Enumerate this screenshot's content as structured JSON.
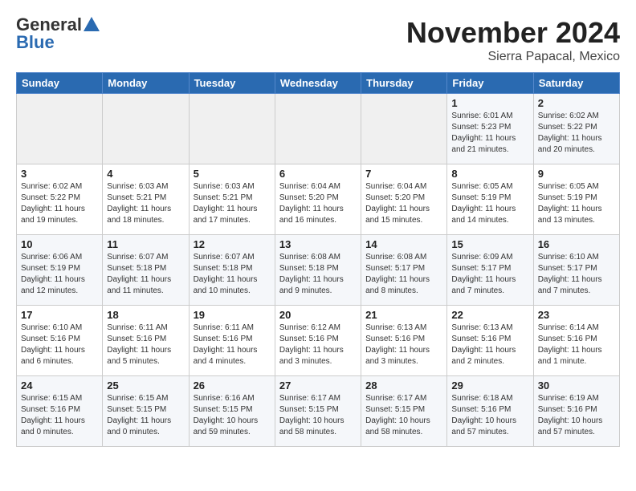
{
  "header": {
    "logo_general": "General",
    "logo_blue": "Blue",
    "month": "November 2024",
    "location": "Sierra Papacal, Mexico"
  },
  "weekdays": [
    "Sunday",
    "Monday",
    "Tuesday",
    "Wednesday",
    "Thursday",
    "Friday",
    "Saturday"
  ],
  "weeks": [
    [
      {
        "day": "",
        "content": ""
      },
      {
        "day": "",
        "content": ""
      },
      {
        "day": "",
        "content": ""
      },
      {
        "day": "",
        "content": ""
      },
      {
        "day": "",
        "content": ""
      },
      {
        "day": "1",
        "content": "Sunrise: 6:01 AM\nSunset: 5:23 PM\nDaylight: 11 hours and 21 minutes."
      },
      {
        "day": "2",
        "content": "Sunrise: 6:02 AM\nSunset: 5:22 PM\nDaylight: 11 hours and 20 minutes."
      }
    ],
    [
      {
        "day": "3",
        "content": "Sunrise: 6:02 AM\nSunset: 5:22 PM\nDaylight: 11 hours and 19 minutes."
      },
      {
        "day": "4",
        "content": "Sunrise: 6:03 AM\nSunset: 5:21 PM\nDaylight: 11 hours and 18 minutes."
      },
      {
        "day": "5",
        "content": "Sunrise: 6:03 AM\nSunset: 5:21 PM\nDaylight: 11 hours and 17 minutes."
      },
      {
        "day": "6",
        "content": "Sunrise: 6:04 AM\nSunset: 5:20 PM\nDaylight: 11 hours and 16 minutes."
      },
      {
        "day": "7",
        "content": "Sunrise: 6:04 AM\nSunset: 5:20 PM\nDaylight: 11 hours and 15 minutes."
      },
      {
        "day": "8",
        "content": "Sunrise: 6:05 AM\nSunset: 5:19 PM\nDaylight: 11 hours and 14 minutes."
      },
      {
        "day": "9",
        "content": "Sunrise: 6:05 AM\nSunset: 5:19 PM\nDaylight: 11 hours and 13 minutes."
      }
    ],
    [
      {
        "day": "10",
        "content": "Sunrise: 6:06 AM\nSunset: 5:19 PM\nDaylight: 11 hours and 12 minutes."
      },
      {
        "day": "11",
        "content": "Sunrise: 6:07 AM\nSunset: 5:18 PM\nDaylight: 11 hours and 11 minutes."
      },
      {
        "day": "12",
        "content": "Sunrise: 6:07 AM\nSunset: 5:18 PM\nDaylight: 11 hours and 10 minutes."
      },
      {
        "day": "13",
        "content": "Sunrise: 6:08 AM\nSunset: 5:18 PM\nDaylight: 11 hours and 9 minutes."
      },
      {
        "day": "14",
        "content": "Sunrise: 6:08 AM\nSunset: 5:17 PM\nDaylight: 11 hours and 8 minutes."
      },
      {
        "day": "15",
        "content": "Sunrise: 6:09 AM\nSunset: 5:17 PM\nDaylight: 11 hours and 7 minutes."
      },
      {
        "day": "16",
        "content": "Sunrise: 6:10 AM\nSunset: 5:17 PM\nDaylight: 11 hours and 7 minutes."
      }
    ],
    [
      {
        "day": "17",
        "content": "Sunrise: 6:10 AM\nSunset: 5:16 PM\nDaylight: 11 hours and 6 minutes."
      },
      {
        "day": "18",
        "content": "Sunrise: 6:11 AM\nSunset: 5:16 PM\nDaylight: 11 hours and 5 minutes."
      },
      {
        "day": "19",
        "content": "Sunrise: 6:11 AM\nSunset: 5:16 PM\nDaylight: 11 hours and 4 minutes."
      },
      {
        "day": "20",
        "content": "Sunrise: 6:12 AM\nSunset: 5:16 PM\nDaylight: 11 hours and 3 minutes."
      },
      {
        "day": "21",
        "content": "Sunrise: 6:13 AM\nSunset: 5:16 PM\nDaylight: 11 hours and 3 minutes."
      },
      {
        "day": "22",
        "content": "Sunrise: 6:13 AM\nSunset: 5:16 PM\nDaylight: 11 hours and 2 minutes."
      },
      {
        "day": "23",
        "content": "Sunrise: 6:14 AM\nSunset: 5:16 PM\nDaylight: 11 hours and 1 minute."
      }
    ],
    [
      {
        "day": "24",
        "content": "Sunrise: 6:15 AM\nSunset: 5:16 PM\nDaylight: 11 hours and 0 minutes."
      },
      {
        "day": "25",
        "content": "Sunrise: 6:15 AM\nSunset: 5:15 PM\nDaylight: 11 hours and 0 minutes."
      },
      {
        "day": "26",
        "content": "Sunrise: 6:16 AM\nSunset: 5:15 PM\nDaylight: 10 hours and 59 minutes."
      },
      {
        "day": "27",
        "content": "Sunrise: 6:17 AM\nSunset: 5:15 PM\nDaylight: 10 hours and 58 minutes."
      },
      {
        "day": "28",
        "content": "Sunrise: 6:17 AM\nSunset: 5:15 PM\nDaylight: 10 hours and 58 minutes."
      },
      {
        "day": "29",
        "content": "Sunrise: 6:18 AM\nSunset: 5:16 PM\nDaylight: 10 hours and 57 minutes."
      },
      {
        "day": "30",
        "content": "Sunrise: 6:19 AM\nSunset: 5:16 PM\nDaylight: 10 hours and 57 minutes."
      }
    ]
  ]
}
